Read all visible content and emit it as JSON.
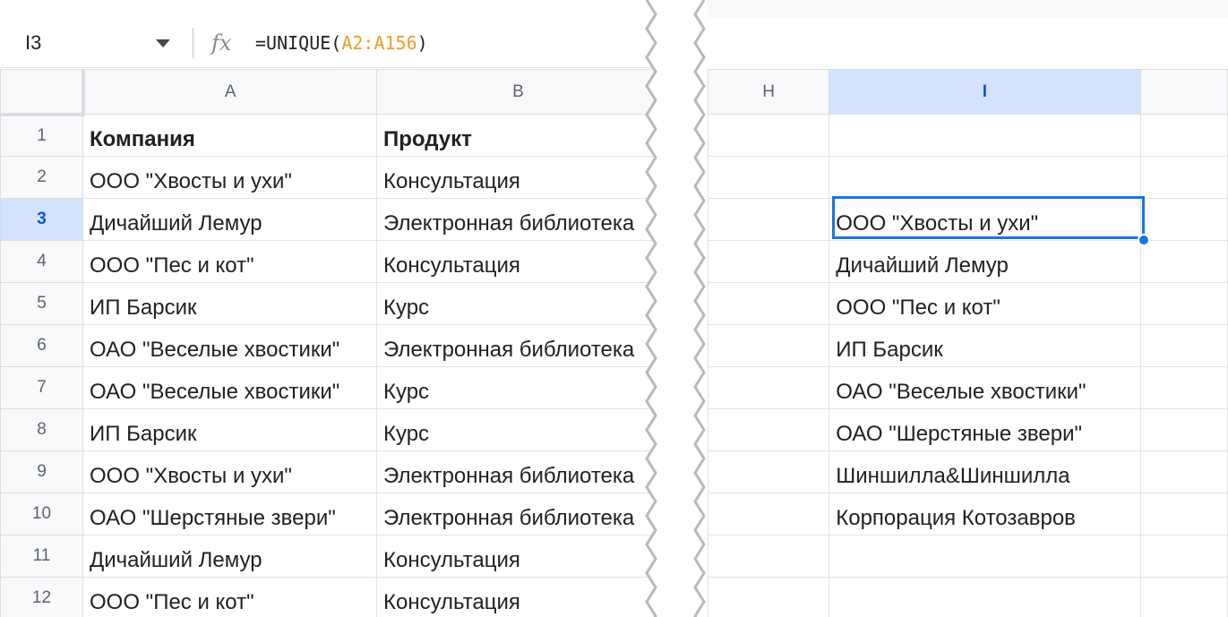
{
  "name_box": {
    "value": "I3"
  },
  "formula_bar": {
    "prefix": "=UNIQUE(",
    "range": "A2:A156",
    "suffix": ")"
  },
  "left_sheet": {
    "columns": [
      "A",
      "B"
    ],
    "rows": [
      {
        "num": "1",
        "a": "Компания",
        "b": "Продукт"
      },
      {
        "num": "2",
        "a": "ООО \"Хвосты и ухи\"",
        "b": "Консультация"
      },
      {
        "num": "3",
        "a": "Дичайший Лемур",
        "b": "Электронная библиотека"
      },
      {
        "num": "4",
        "a": "ООО \"Пес и кот\"",
        "b": "Консультация"
      },
      {
        "num": "5",
        "a": "ИП Барсик",
        "b": "Курс"
      },
      {
        "num": "6",
        "a": "ОАО \"Веселые хвостики\"",
        "b": "Электронная библиотека"
      },
      {
        "num": "7",
        "a": "ОАО \"Веселые хвостики\"",
        "b": "Курс"
      },
      {
        "num": "8",
        "a": "ИП Барсик",
        "b": "Курс"
      },
      {
        "num": "9",
        "a": "ООО \"Хвосты и ухи\"",
        "b": "Электронная библиотека"
      },
      {
        "num": "10",
        "a": "ОАО \"Шерстяные звери\"",
        "b": "Электронная библиотека"
      },
      {
        "num": "11",
        "a": "Дичайший Лемур",
        "b": "Консультация"
      },
      {
        "num": "12",
        "a": "ООО \"Пес и кот\"",
        "b": "Консультация"
      }
    ]
  },
  "right_sheet": {
    "columns": [
      "H",
      "I"
    ],
    "column_i_values": [
      "",
      "",
      "ООО \"Хвосты и ухи\"",
      "Дичайший Лемур",
      "ООО \"Пес и кот\"",
      "ИП Барсик",
      "ОАО \"Веселые хвостики\"",
      "ОАО \"Шерстяные звери\"",
      "Шиншилла&Шиншилла",
      "Корпорация Котозавров",
      "",
      ""
    ]
  },
  "colors": {
    "selection": "#1a73e8",
    "header_selected_bg": "#d3e3fd",
    "header_selected_text": "#0b57d0",
    "formula_range": "#f09c2a"
  },
  "icons": {
    "fx": "fx-icon",
    "dropdown": "chevron-down-icon"
  }
}
